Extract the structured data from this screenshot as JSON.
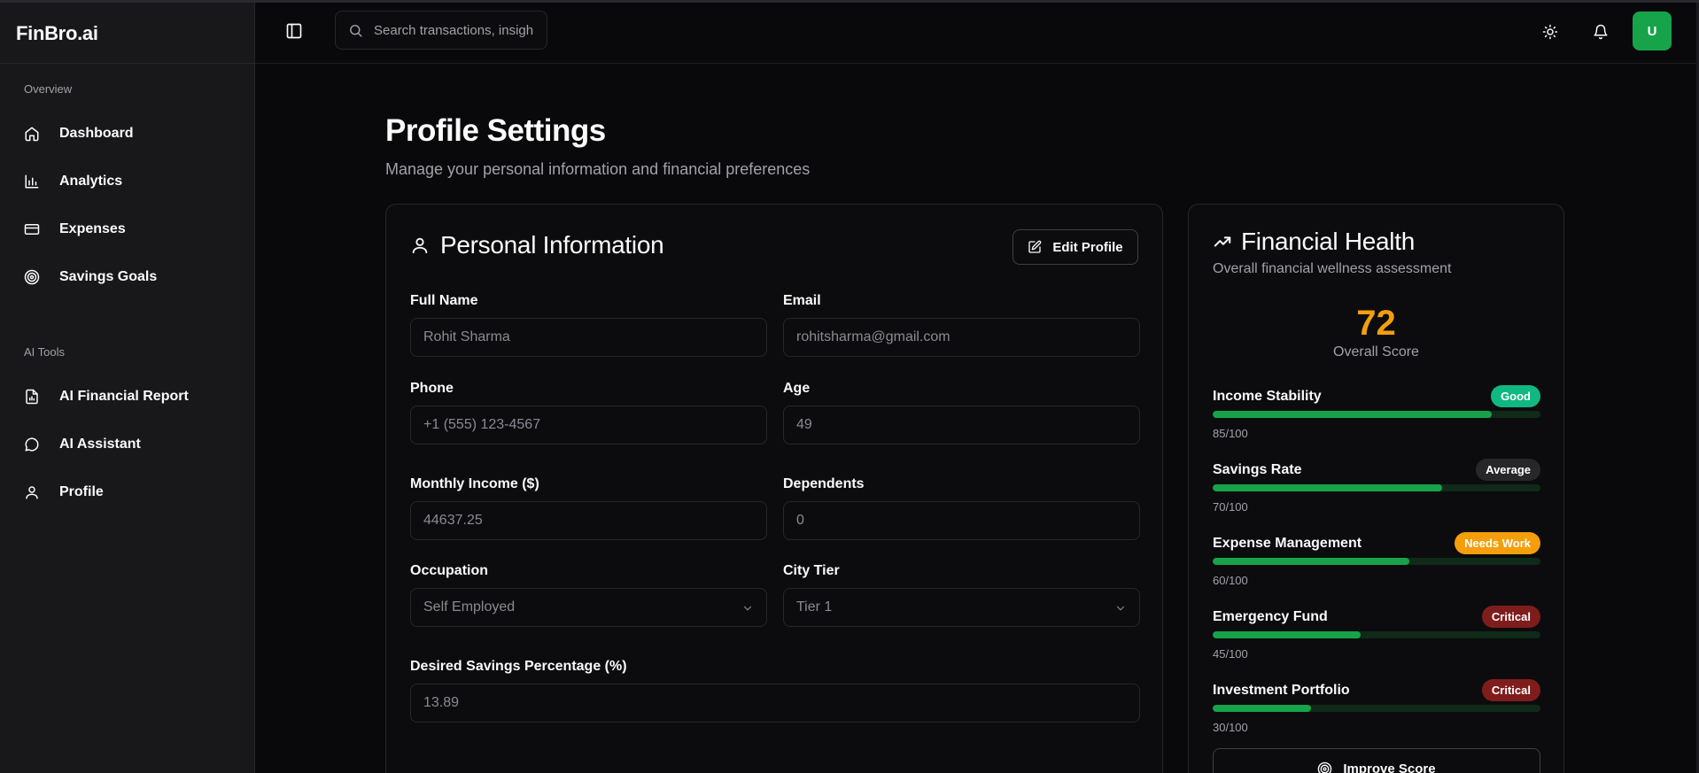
{
  "app": {
    "brand": "FinBro.ai"
  },
  "sidebar": {
    "groups": [
      {
        "label": "Overview",
        "items": [
          {
            "label": "Dashboard",
            "icon": "home-icon"
          },
          {
            "label": "Analytics",
            "icon": "bar-chart-icon"
          },
          {
            "label": "Expenses",
            "icon": "credit-card-icon"
          },
          {
            "label": "Savings Goals",
            "icon": "target-icon"
          }
        ]
      },
      {
        "label": "AI Tools",
        "items": [
          {
            "label": "AI Financial Report",
            "icon": "file-chart-icon"
          },
          {
            "label": "AI Assistant",
            "icon": "chat-bubble-icon"
          },
          {
            "label": "Profile",
            "icon": "user-icon"
          }
        ]
      }
    ]
  },
  "topbar": {
    "search_placeholder": "Search transactions, insights...",
    "avatar_initial": "U"
  },
  "page": {
    "title": "Profile Settings",
    "subtitle": "Manage your personal information and financial preferences"
  },
  "personal_info": {
    "title": "Personal Information",
    "edit_label": "Edit Profile",
    "fields": {
      "full_name": {
        "label": "Full Name",
        "value": "Rohit Sharma"
      },
      "email": {
        "label": "Email",
        "value": "rohitsharma@gmail.com"
      },
      "phone": {
        "label": "Phone",
        "placeholder": "+1 (555) 123-4567"
      },
      "age": {
        "label": "Age",
        "value": "49"
      },
      "monthly_income": {
        "label": "Monthly Income ($)",
        "value": "44637.25"
      },
      "dependents": {
        "label": "Dependents",
        "value": "0"
      },
      "occupation": {
        "label": "Occupation",
        "value": "Self Employed"
      },
      "city_tier": {
        "label": "City Tier",
        "value": "Tier 1"
      },
      "desired_savings": {
        "label": "Desired Savings Percentage (%)",
        "value": "13.89"
      }
    }
  },
  "financial_health": {
    "title": "Financial Health",
    "subtitle": "Overall financial wellness assessment",
    "score": "72",
    "score_label": "Overall Score",
    "score_color": "#f59e0b",
    "metrics": [
      {
        "name": "Income Stability",
        "badge": "Good",
        "badge_color": "#10b981",
        "badge_text": "#ffffff",
        "value": 85,
        "value_text": "85/100"
      },
      {
        "name": "Savings Rate",
        "badge": "Average",
        "badge_color": "#27272a",
        "badge_text": "#ffffff",
        "value": 70,
        "value_text": "70/100"
      },
      {
        "name": "Expense Management",
        "badge": "Needs Work",
        "badge_color": "#f59e0b",
        "badge_text": "#ffffff",
        "value": 60,
        "value_text": "60/100"
      },
      {
        "name": "Emergency Fund",
        "badge": "Critical",
        "badge_color": "#7f1d1d",
        "badge_text": "#ffffff",
        "value": 45,
        "value_text": "45/100"
      },
      {
        "name": "Investment Portfolio",
        "badge": "Critical",
        "badge_color": "#7f1d1d",
        "badge_text": "#ffffff",
        "value": 30,
        "value_text": "30/100"
      }
    ],
    "improve_label": "Improve Score"
  }
}
